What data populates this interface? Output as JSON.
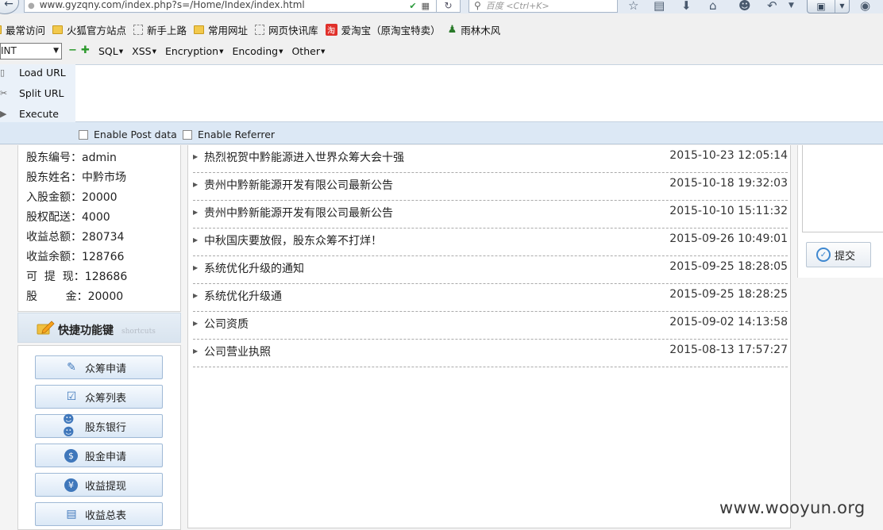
{
  "browser": {
    "url": "www.gyzqny.com/index.php?s=/Home/Index/index.html",
    "search_placeholder": "百度 <Ctrl+K>",
    "icons": [
      "back-arrow-icon",
      "reload-icon",
      "star-icon",
      "reading-list-icon",
      "download-icon",
      "home-icon",
      "emoji-icon",
      "undo-icon",
      "window-icon",
      "chat-icon"
    ]
  },
  "bookmarks": [
    {
      "label": "最常访问",
      "icon": "folder-icon"
    },
    {
      "label": "火狐官方站点",
      "icon": "folder-icon"
    },
    {
      "label": "新手上路",
      "icon": "page-icon"
    },
    {
      "label": "常用网址",
      "icon": "folder-icon"
    },
    {
      "label": "网页快讯库",
      "icon": "page-icon"
    },
    {
      "label": "爱淘宝（原淘宝特卖）",
      "icon": "taobao-icon",
      "icon_text": "淘"
    },
    {
      "label": "雨林木风",
      "icon": "tree-icon"
    }
  ],
  "hackbar": {
    "select_value": "INT",
    "menus": [
      "SQL",
      "XSS",
      "Encryption",
      "Encoding",
      "Other"
    ],
    "load_url": "Load URL",
    "split_url": "Split URL",
    "execute": "Execute",
    "enable_post": "Enable Post data",
    "enable_referrer": "Enable Referrer"
  },
  "shareholder": [
    "股东编号：admin",
    "股东姓名：中黔市场",
    "入股金额：20000",
    "股权配送：4000",
    "收益总额：280734",
    "收益余额：128766",
    "可  提  现：128686",
    "股        金：20000"
  ],
  "shortcuts": {
    "title": "快捷功能键",
    "subtitle": "shortcuts",
    "buttons": [
      "众筹申请",
      "众筹列表",
      "股东银行",
      "股金申请",
      "收益提现",
      "收益总表"
    ]
  },
  "news": [
    {
      "title": "热烈祝贺中黔能源进入世界众筹大会十强",
      "date": "2015-10-23 12:05:14"
    },
    {
      "title": "贵州中黔新能源开发有限公司最新公告",
      "date": "2015-10-18 19:32:03"
    },
    {
      "title": "贵州中黔新能源开发有限公司最新公告",
      "date": "2015-10-10 15:11:32"
    },
    {
      "title": "中秋国庆要放假，股东众筹不打烊！",
      "date": "2015-09-26 10:49:01"
    },
    {
      "title": "系统优化升级的通知",
      "date": "2015-09-25 18:28:05"
    },
    {
      "title": "系统优化升级通",
      "date": "2015-09-25 18:28:25"
    },
    {
      "title": "公司资质",
      "date": "2015-09-02 14:13:58"
    },
    {
      "title": "公司营业执照",
      "date": "2015-08-13 17:57:27"
    }
  ],
  "submit_label": "提交",
  "watermark": "www.wooyun.org"
}
